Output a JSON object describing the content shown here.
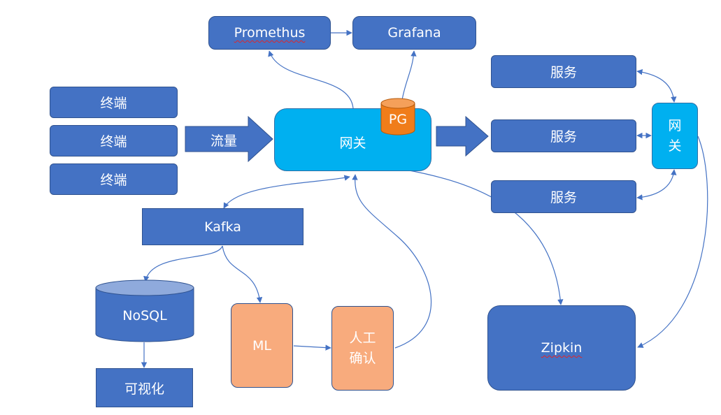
{
  "nodes": {
    "prometheus": "Promethus",
    "grafana": "Grafana",
    "terminal_1": "终端",
    "terminal_2": "终端",
    "terminal_3": "终端",
    "traffic": "流量",
    "gateway_main": "网关",
    "pg": "PG",
    "service_1": "服务",
    "service_2": "服务",
    "service_3": "服务",
    "gateway_side_1": "网",
    "gateway_side_2": "关",
    "kafka": "Kafka",
    "nosql": "NoSQL",
    "visualization": "可视化",
    "ml": "ML",
    "manual_1": "人工",
    "manual_2": "确认",
    "zipkin": "Zipkin"
  },
  "colors": {
    "box_blue": "#4472c4",
    "gateway_cyan": "#00b0f0",
    "pg_orange": "#f07d1a",
    "ml_salmon": "#f8ab7d",
    "connector": "#4472c4"
  }
}
